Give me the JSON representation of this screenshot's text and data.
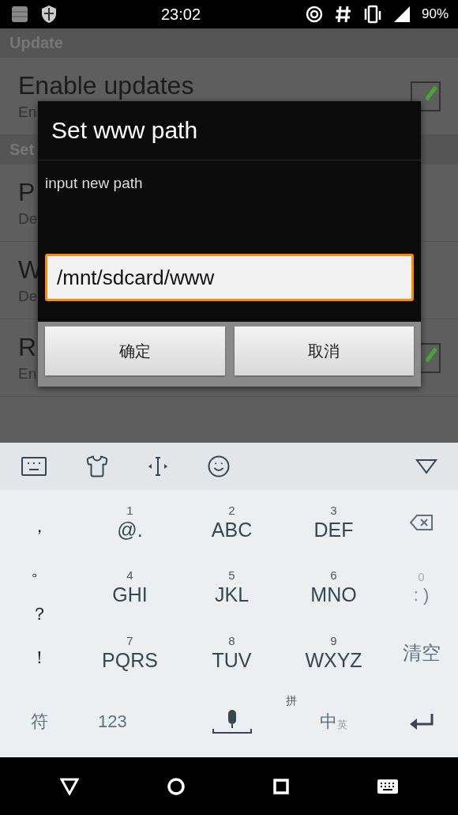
{
  "status_bar": {
    "time": "23:02",
    "battery": "90%"
  },
  "settings": {
    "sections": [
      {
        "title": "Update",
        "items": [
          {
            "title": "Enable updates",
            "subtitle": "En",
            "kind": "checkbox",
            "checked": true
          }
        ]
      },
      {
        "title": "Set",
        "items": [
          {
            "title": "P",
            "subtitle": "De",
            "kind": "plain"
          },
          {
            "title": "W",
            "subtitle": "De",
            "kind": "plain"
          },
          {
            "title": "R",
            "subtitle": "En",
            "kind": "checkbox",
            "checked": true
          }
        ]
      }
    ]
  },
  "dialog": {
    "title": "Set www path",
    "message": "input new path",
    "input": {
      "value": "/mnt/sdcard/www",
      "focused": true
    },
    "buttons": [
      "确定",
      "取消"
    ]
  },
  "keyboard": {
    "symbols": [
      "，",
      "。",
      "？",
      "！"
    ],
    "keys": [
      {
        "digit": "1",
        "letters": "@."
      },
      {
        "digit": "2",
        "letters": "ABC"
      },
      {
        "digit": "3",
        "letters": "DEF"
      },
      {
        "digit": "4",
        "letters": "GHI"
      },
      {
        "digit": "5",
        "letters": "JKL"
      },
      {
        "digit": "6",
        "letters": "MNO"
      },
      {
        "digit": "7",
        "letters": "PQRS"
      },
      {
        "digit": "8",
        "letters": "TUV"
      },
      {
        "digit": "9",
        "letters": "WXYZ"
      }
    ],
    "side_keys": [
      {
        "kind": "backspace"
      },
      {
        "kind": "key",
        "digit": "0",
        "label": ": )"
      },
      {
        "kind": "text",
        "label": "清空"
      }
    ],
    "bottom": {
      "symbols": "符",
      "numbers": "123",
      "pinyin": "拼",
      "language": "中",
      "language_alt": "英"
    }
  }
}
